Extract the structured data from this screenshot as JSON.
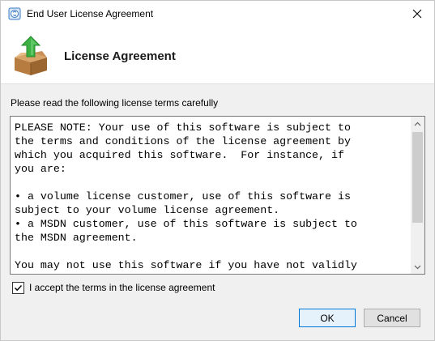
{
  "window": {
    "title": "End User License Agreement",
    "icon": "installer-app-icon",
    "close_icon": "close-icon"
  },
  "header": {
    "title": "License Agreement",
    "icon": "package-box-green-arrow-icon"
  },
  "instruction": "Please read the following license terms carefully",
  "license": {
    "lines": [
      "PLEASE NOTE: Your use of this software is subject to",
      "the terms and conditions of the license agreement by",
      "which you acquired this software.  For instance, if",
      "you are:",
      "",
      "• a volume license customer, use of this software is",
      "subject to your volume license agreement.",
      "• a MSDN customer, use of this software is subject to",
      "the MSDN agreement.",
      "",
      "You may not use this software if you have not validly"
    ]
  },
  "accept": {
    "label": "I accept the terms in the license agreement",
    "checked": true
  },
  "buttons": {
    "ok": "OK",
    "cancel": "Cancel"
  },
  "colors": {
    "ok_border": "#0078d7",
    "ok_fill": "#e5f1fb",
    "arrow_green": "#3cb043",
    "box_brown": "#c48a4a"
  }
}
